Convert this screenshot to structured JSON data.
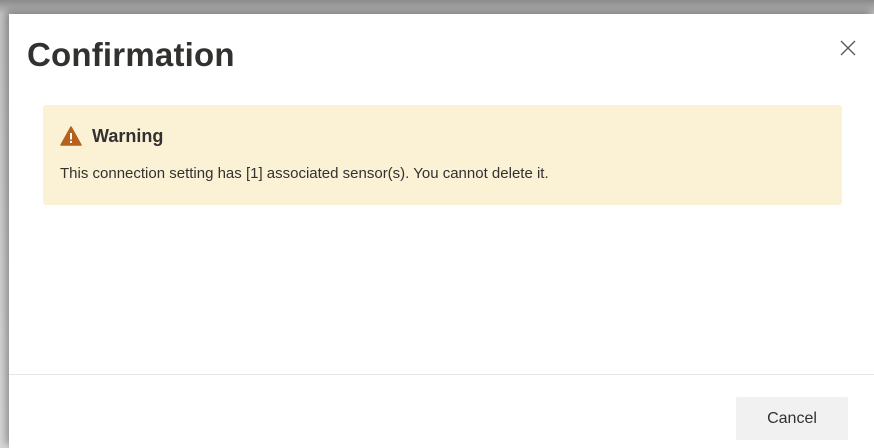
{
  "dialog": {
    "title": "Confirmation",
    "close_icon": "close-icon"
  },
  "message": {
    "icon": "warning-icon",
    "title": "Warning",
    "text": "This connection setting has [1] associated sensor(s). You cannot delete it.",
    "background_color": "#fbf1d5",
    "icon_color": "#b5611d"
  },
  "footer": {
    "cancel_label": "Cancel"
  }
}
